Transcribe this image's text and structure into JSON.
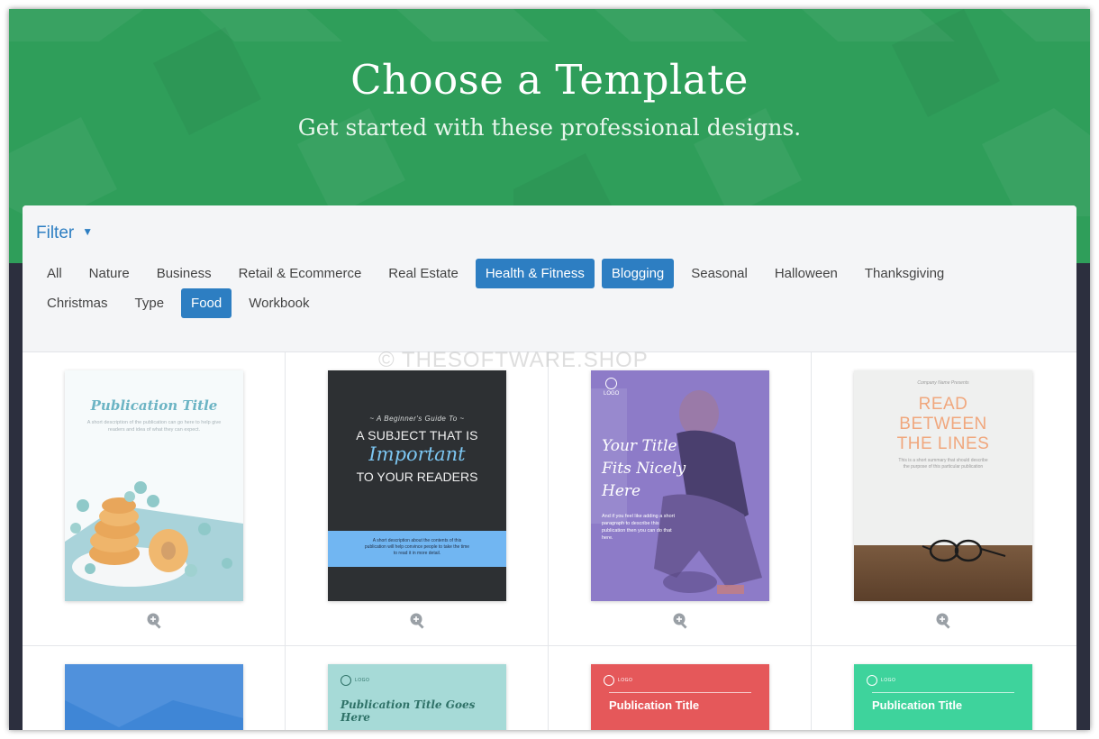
{
  "hero": {
    "title": "Choose a Template",
    "subtitle": "Get started with these professional designs."
  },
  "filter": {
    "label": "Filter",
    "caret_icon": "caret-down-icon",
    "categories_row1": [
      {
        "label": "All",
        "active": false
      },
      {
        "label": "Nature",
        "active": false
      },
      {
        "label": "Business",
        "active": false
      },
      {
        "label": "Retail & Ecommerce",
        "active": false
      },
      {
        "label": "Real Estate",
        "active": false
      },
      {
        "label": "Health & Fitness",
        "active": true
      },
      {
        "label": "Blogging",
        "active": true
      },
      {
        "label": "Seasonal",
        "active": false
      },
      {
        "label": "Halloween",
        "active": false
      },
      {
        "label": "Thanksgiving",
        "active": false
      }
    ],
    "categories_row2": [
      {
        "label": "Christmas",
        "active": false
      },
      {
        "label": "Type",
        "active": false
      },
      {
        "label": "Food",
        "active": true
      },
      {
        "label": "Workbook",
        "active": false
      }
    ]
  },
  "templates": {
    "card1": {
      "title": "Publication Title",
      "desc": "A short description of the publication can go here to help give readers and idea of what they can expect."
    },
    "card2": {
      "kicker": "~ A Beginner's Guide To ~",
      "line1": "A SUBJECT THAT IS",
      "line2": "Important",
      "line3": "TO YOUR READERS",
      "band_text": "A short description about the contents of this publication will help convince people to take the time to read it in more detail."
    },
    "card3": {
      "logo": "LOGO",
      "title_lines": [
        "Your Title",
        "Fits Nicely",
        "Here"
      ],
      "desc": "And if you feel like adding a short paragraph to describe this publication then you can do that here."
    },
    "card4": {
      "kicker": "Company Name Presents",
      "title_lines": [
        "READ",
        "BETWEEN",
        "THE LINES"
      ],
      "desc": "This is a short summary that should describe the purpose of this particular publication"
    },
    "card6": {
      "logo": "LOGO",
      "title": "Publication Title Goes Here"
    },
    "card7": {
      "logo": "LOGO",
      "title": "Publication Title"
    },
    "card8": {
      "logo": "LOGO",
      "title": "Publication Title"
    }
  },
  "watermark": "© THESOFTWARE.SHOP",
  "icons": {
    "zoom": "zoom-in-icon"
  },
  "colors": {
    "hero_green": "#2f9e5a",
    "accent_blue": "#2d7ec2",
    "dark_bg": "#2c2f3e"
  }
}
